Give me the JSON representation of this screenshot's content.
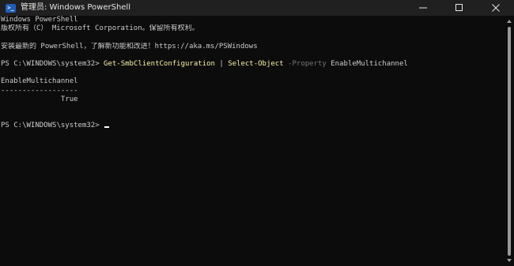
{
  "window": {
    "title": "管理员: Windows PowerShell",
    "icon": "powershell-icon",
    "icon_glyph": ">_",
    "background_color": "#0c0c0c",
    "titlebar_color": "#202020"
  },
  "console": {
    "header_line_1": "Windows PowerShell",
    "header_line_2": "版权所有（C） Microsoft Corporation。保留所有权利。",
    "install_message": "安装最新的 PowerShell，了解新功能和改进！https://aka.ms/PSWindows",
    "command_prompt": "PS C:\\WINDOWS\\system32> ",
    "command_cmdlet": "Get-SmbClientConfiguration",
    "command_pipe": " | ",
    "command_cmdlet_2": "Select-Object",
    "command_param": " -Property",
    "command_value": " EnableMultichannel",
    "output_header": "EnableMultichannel",
    "output_separator": "------------------",
    "output_value": "              True",
    "current_prompt": "PS C:\\WINDOWS\\system32> ",
    "colors": {
      "text": "#cccccc",
      "cmdlet": "#f9f1a5",
      "parameter": "#767676"
    }
  }
}
